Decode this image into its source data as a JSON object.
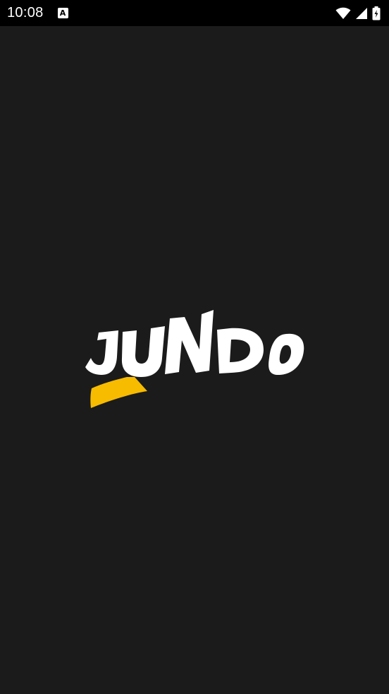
{
  "status_bar": {
    "time": "10:08",
    "notification_icon": "a-box-icon",
    "notification_glyph": "A",
    "icons": [
      "wifi-icon",
      "cellular-signal-icon",
      "battery-charging-icon"
    ]
  },
  "splash": {
    "logo_text": "JUNDO",
    "logo_name": "jundo-logo"
  },
  "colors": {
    "background": "#1b1b1b",
    "status_bar": "#000000",
    "logo_text": "#ffffff",
    "accent": "#f7bb00"
  }
}
